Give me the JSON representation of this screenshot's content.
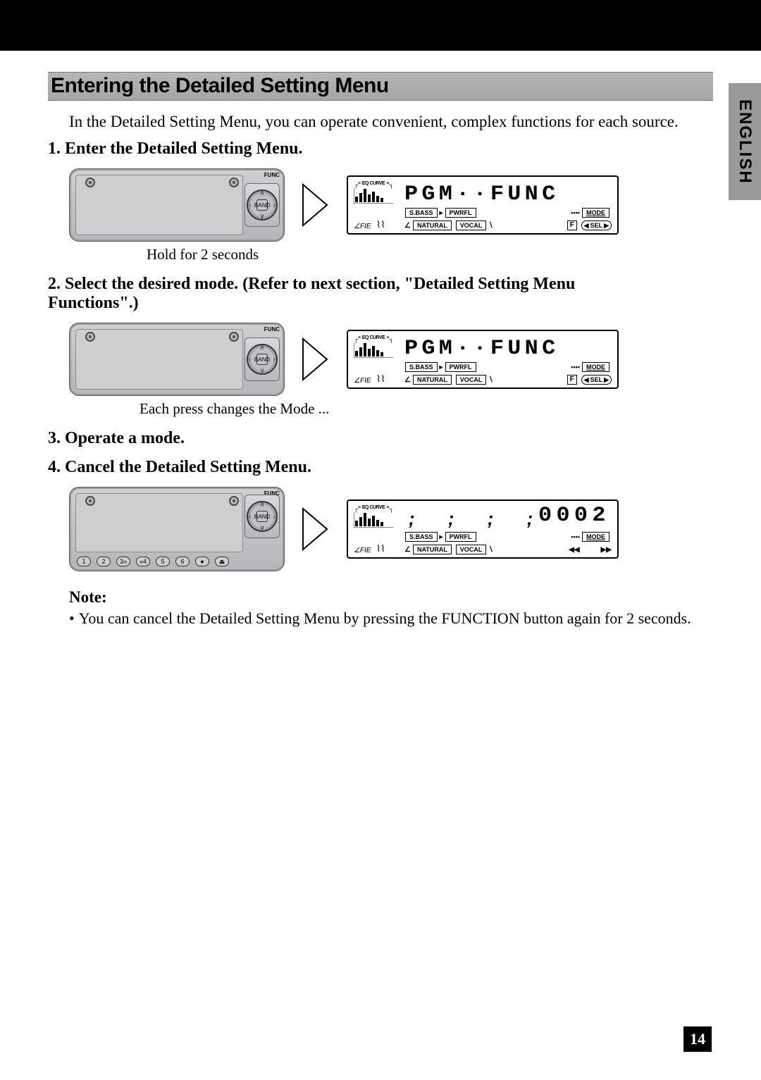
{
  "sideTab": "ENGLISH",
  "section": {
    "title": "Entering the Detailed Setting Menu",
    "intro": "In the Detailed Setting Menu, you can operate convenient, complex functions for each source."
  },
  "steps": {
    "s1": "1.  Enter the Detailed Setting Menu.",
    "s2": "2.  Select the desired mode. (Refer to next section, \"Detailed Setting Menu Functions\".)",
    "s3": "3.  Operate a mode.",
    "s4": "4.  Cancel the Detailed Setting Menu."
  },
  "captions": {
    "c1": "Hold for 2 seconds",
    "c2": "Each press changes the Mode ..."
  },
  "device": {
    "funcLabel": "FUNC",
    "centerBtn": "BAND",
    "buttons": [
      "1",
      "2",
      "3»",
      "«4",
      "5",
      "6",
      "●",
      "⏏︎"
    ]
  },
  "lcd": {
    "eqLabel": "EQ CURVE",
    "main1": "PGM··FUNC",
    "main2": "PGM··FUNC",
    "main3": "0002",
    "sbass": "S.BASS",
    "pwrfl": "PWRFL",
    "mode": "MODE",
    "fie": "FIE",
    "natural": "NATURAL",
    "vocal": "VOCAL",
    "f": "F",
    "sel": "SEL",
    "ticks": "♪♪♪♪",
    "rew": "◀◀",
    "ff": "▶▶"
  },
  "note": {
    "heading": "Note:",
    "bullet": "•",
    "text": "You can cancel the Detailed Setting Menu by pressing the FUNCTION button again for 2 seconds."
  },
  "pageNumber": "14"
}
